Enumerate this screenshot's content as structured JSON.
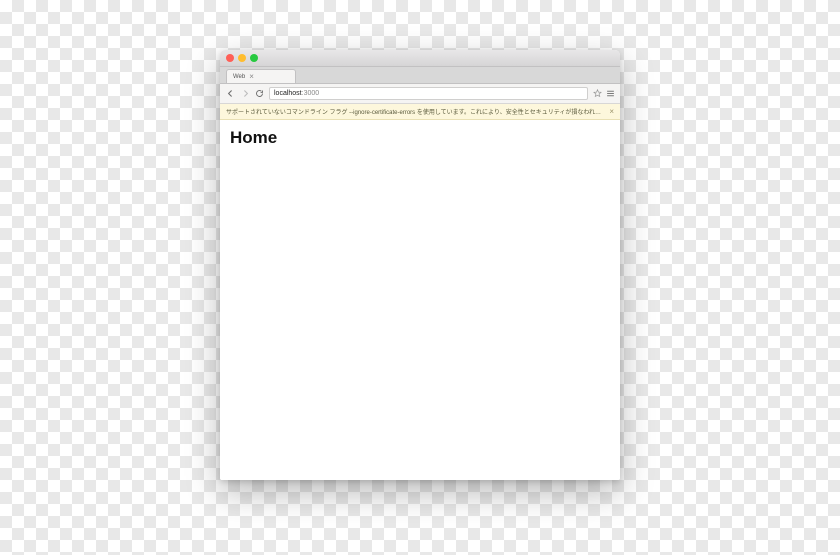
{
  "window": {
    "tab_title": "Web"
  },
  "toolbar": {
    "address_host": "localhost",
    "address_port": ":3000"
  },
  "warning": {
    "text": "サポートされていないコマンドライン フラグ --ignore-certificate-errors を使用しています。これにより、安全性とセキュリティが損なわれます。"
  },
  "page": {
    "heading": "Home"
  }
}
